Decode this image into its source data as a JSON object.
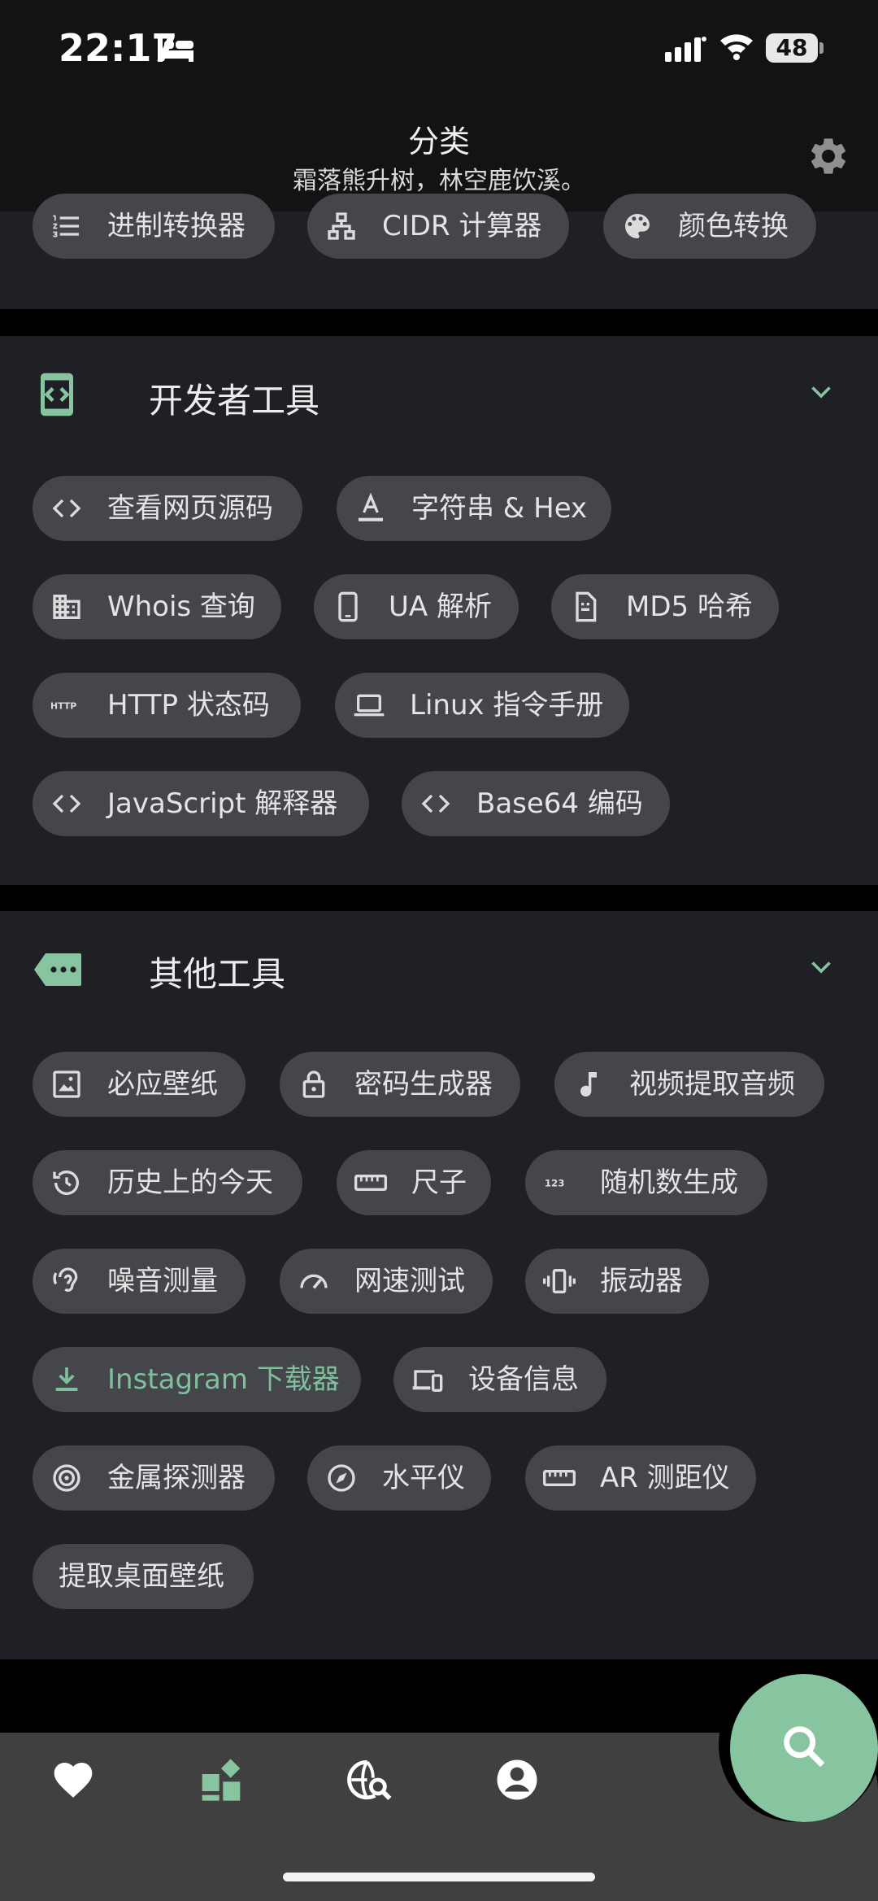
{
  "status": {
    "time": "22:17",
    "battery": "48"
  },
  "header": {
    "title": "分类",
    "subtitle": "霜落熊升树，林空鹿饮溪。"
  },
  "top_chips": [
    {
      "label": "进制转换器",
      "icon": "list-numbered-icon"
    },
    {
      "label": "CIDR 计算器",
      "icon": "network-tree-icon"
    },
    {
      "label": "颜色转换",
      "icon": "palette-icon"
    }
  ],
  "dev_section": {
    "title": "开发者工具",
    "icon": "code-bracket-icon",
    "chips": [
      {
        "label": "查看网页源码",
        "icon": "code-icon"
      },
      {
        "label": "字符串 & Hex",
        "icon": "text-format-icon"
      },
      {
        "label": "Whois 查询",
        "icon": "building-icon"
      },
      {
        "label": "UA 解析",
        "icon": "phone-icon"
      },
      {
        "label": "MD5 哈希",
        "icon": "file-icon"
      },
      {
        "label": "HTTP 状态码",
        "icon": "http-icon"
      },
      {
        "label": "Linux 指令手册",
        "icon": "laptop-icon"
      },
      {
        "label": "JavaScript 解释器",
        "icon": "code-icon"
      },
      {
        "label": "Base64 编码",
        "icon": "code-icon"
      }
    ]
  },
  "other_section": {
    "title": "其他工具",
    "icon": "tag-dots-icon",
    "chips": [
      {
        "label": "必应壁纸",
        "icon": "image-icon"
      },
      {
        "label": "密码生成器",
        "icon": "lock-icon"
      },
      {
        "label": "视频提取音频",
        "icon": "music-note-icon"
      },
      {
        "label": "历史上的今天",
        "icon": "history-icon"
      },
      {
        "label": "尺子",
        "icon": "ruler-icon"
      },
      {
        "label": "随机数生成",
        "icon": "numbers-icon"
      },
      {
        "label": "噪音测量",
        "icon": "ear-icon"
      },
      {
        "label": "网速测试",
        "icon": "speedometer-icon"
      },
      {
        "label": "振动器",
        "icon": "vibration-icon"
      },
      {
        "label": "Instagram 下载器",
        "icon": "download-icon"
      },
      {
        "label": "设备信息",
        "icon": "devices-icon"
      },
      {
        "label": "金属探测器",
        "icon": "target-icon"
      },
      {
        "label": "水平仪",
        "icon": "compass-icon"
      },
      {
        "label": "AR 测距仪",
        "icon": "ruler-icon"
      },
      {
        "label": "提取桌面壁纸",
        "icon": ""
      }
    ]
  },
  "nav": [
    "heart-icon",
    "widgets-icon",
    "globe-search-icon",
    "account-icon"
  ],
  "fab": "search-icon",
  "colors": {
    "accent": "#87c5a0",
    "chip_bg": "#45464b",
    "section_bg": "#1f2025"
  }
}
